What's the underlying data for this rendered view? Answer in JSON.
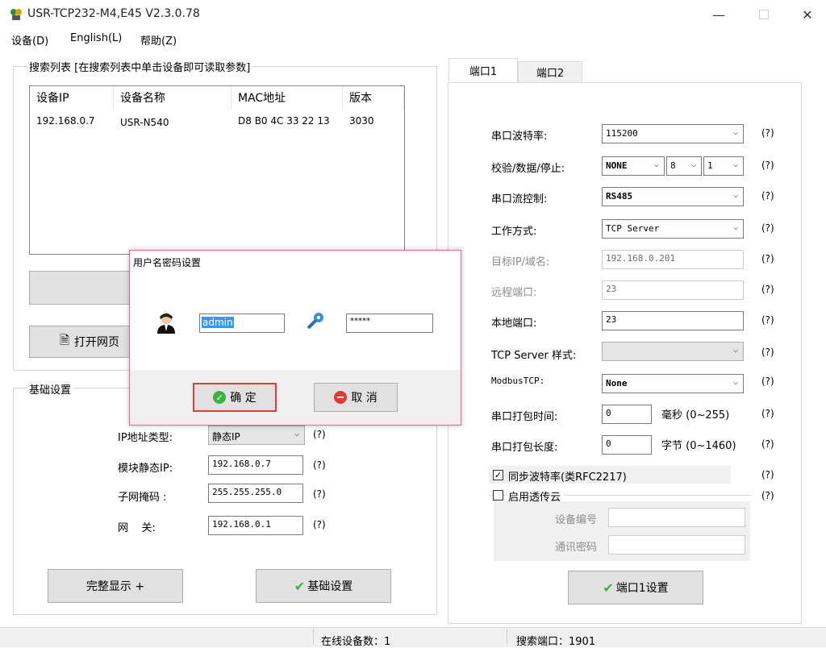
{
  "window": {
    "title": "USR-TCP232-M4,E45 V2.3.0.78"
  },
  "menu": [
    {
      "label": "设备(D)"
    },
    {
      "label": "English(L)"
    },
    {
      "label": "帮助(Z)"
    }
  ],
  "search_group": {
    "title": "搜索列表 [在搜索列表中单击设备即可读取参数]",
    "columns": [
      "设备IP",
      "设备名称",
      "MAC地址",
      "版本"
    ],
    "rows": [
      {
        "ip": "192.168.0.7",
        "name": "USR-N540",
        "mac": "D8 B0 4C 33 22 13",
        "version": "3030"
      }
    ],
    "open_web_label": "打开网页"
  },
  "basic_group": {
    "title": "基础设置",
    "ip_type_label": "IP地址类型:",
    "ip_type_value": "静态IP",
    "static_ip_label": "模块静态IP:",
    "static_ip_value": "192.168.0.7",
    "subnet_label": "子网掩码 :",
    "subnet_value": "255.255.255.0",
    "gateway_label": "网    关:",
    "gateway_value": "192.168.0.1",
    "help": "(?)",
    "full_display_label": "完整显示 +",
    "basic_settings_label": "基础设置"
  },
  "tabs": [
    {
      "label": "端口1"
    },
    {
      "label": "端口2"
    }
  ],
  "port": {
    "help": "(?)",
    "baud_label": "串口波特率:",
    "baud_value": "115200",
    "check_label": "校验/数据/停止:",
    "parity_value": "NONE",
    "databits_value": "8",
    "stopbits_value": "1",
    "flow_label": "串口流控制:",
    "flow_value": "RS485",
    "mode_label": "工作方式:",
    "mode_value": "TCP Server",
    "target_label": "目标IP/域名:",
    "target_value": "192.168.0.201",
    "remote_port_label": "远程端口:",
    "remote_port_value": "23",
    "local_port_label": "本地端口:",
    "local_port_value": "23",
    "server_style_label": "TCP Server 样式:",
    "server_style_value": "",
    "modbus_label": "ModbusTCP:",
    "modbus_value": "None",
    "pack_time_label": "串口打包时间:",
    "pack_time_value": "0",
    "pack_time_unit": "毫秒 (0~255)",
    "pack_len_label": "串口打包长度:",
    "pack_len_value": "0",
    "pack_len_unit": "字节 (0~1460)",
    "sync_baud_label": "同步波特率(类RFC2217)",
    "sync_baud_checked": true,
    "cloud_label": "启用透传云",
    "cloud_checked": false,
    "device_no_label": "设备编号",
    "device_no_value": "",
    "comm_pwd_label": "通讯密码",
    "comm_pwd_value": "",
    "port_set_label": "端口1设置"
  },
  "status": {
    "online": "在线设备数：1",
    "search_port": "搜索端口：1901"
  },
  "dialog": {
    "title": "用户名密码设置",
    "username_value": "admin",
    "password_value": "*****",
    "ok_label": "确 定",
    "cancel_label": "取 消"
  },
  "colors": {
    "dialog_border": "#e5688c",
    "highlight": "#e03a3a",
    "selection": "#3399ff",
    "ok_green": "#3cb043",
    "cancel_red": "#e53935"
  }
}
